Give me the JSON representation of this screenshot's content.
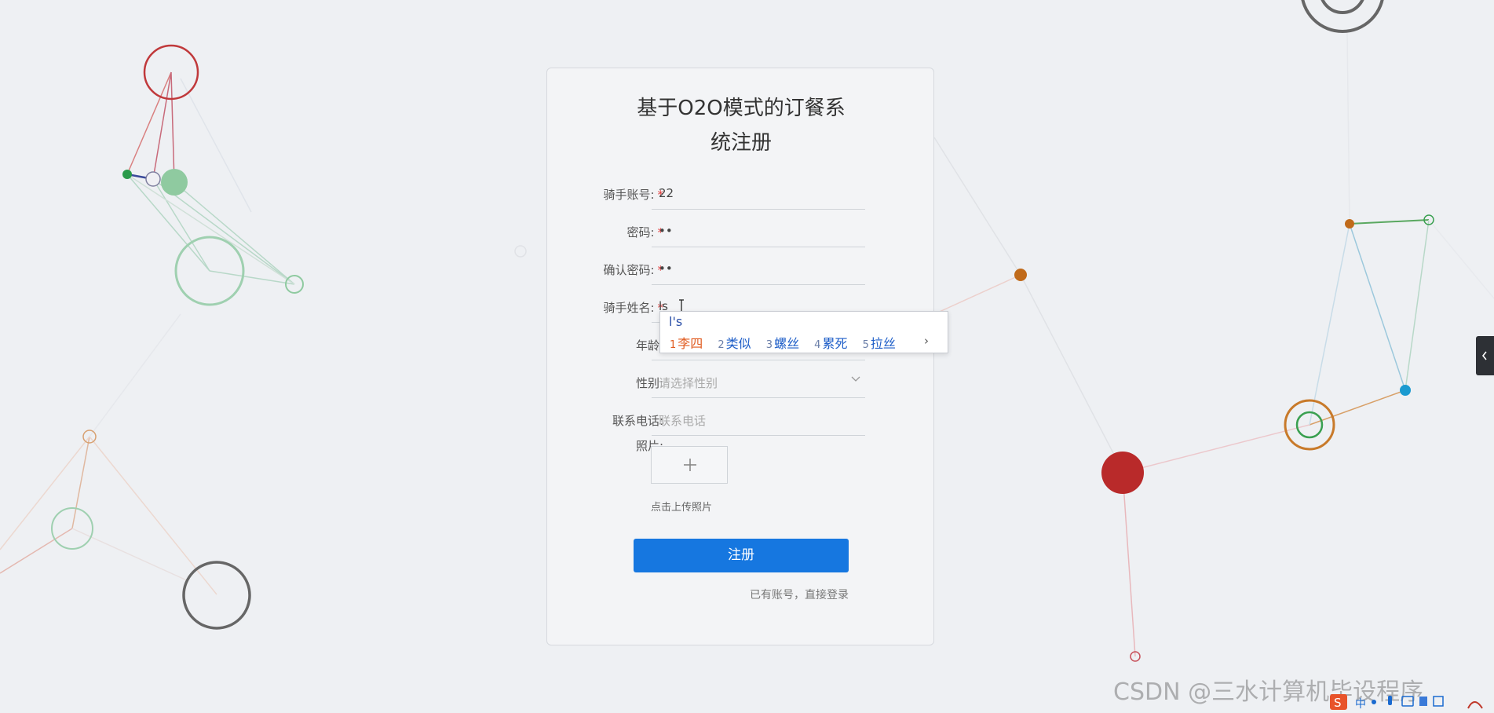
{
  "form": {
    "title_line1": "基于O2O模式的订餐系",
    "title_line2": "统注册",
    "fields": [
      {
        "label": "骑手账号:",
        "required": true,
        "value": "22",
        "placeholder": ""
      },
      {
        "label": "密码:",
        "required": true,
        "value": "••",
        "placeholder": ""
      },
      {
        "label": "确认密码:",
        "required": true,
        "value": "••",
        "placeholder": ""
      },
      {
        "label": "骑手姓名:",
        "required": true,
        "value": "ls",
        "placeholder": ""
      },
      {
        "label": "年龄:",
        "required": false,
        "value": "",
        "placeholder": ""
      },
      {
        "label": "性别:",
        "required": false,
        "value": "",
        "placeholder": "请选择性别"
      },
      {
        "label": "联系电话:",
        "required": false,
        "value": "",
        "placeholder": "联系电话"
      },
      {
        "label": "照片:",
        "required": false
      }
    ],
    "required_mark": "*",
    "upload_hint": "点击上传照片",
    "submit_label": "注册",
    "login_link": "已有账号，直接登录"
  },
  "ime": {
    "composition": "l's",
    "candidates": [
      {
        "num": "1",
        "text": "李四"
      },
      {
        "num": "2",
        "text": "类似"
      },
      {
        "num": "3",
        "text": "螺丝"
      },
      {
        "num": "4",
        "text": "累死"
      },
      {
        "num": "5",
        "text": "拉丝"
      }
    ],
    "next_arrow": "›"
  },
  "watermark": "CSDN @三水计算机毕设程序",
  "colors": {
    "primary": "#1677e0",
    "required": "#e23b3b",
    "ime_selected": "#e05a1e",
    "ime_candidate": "#1e5ec8"
  }
}
